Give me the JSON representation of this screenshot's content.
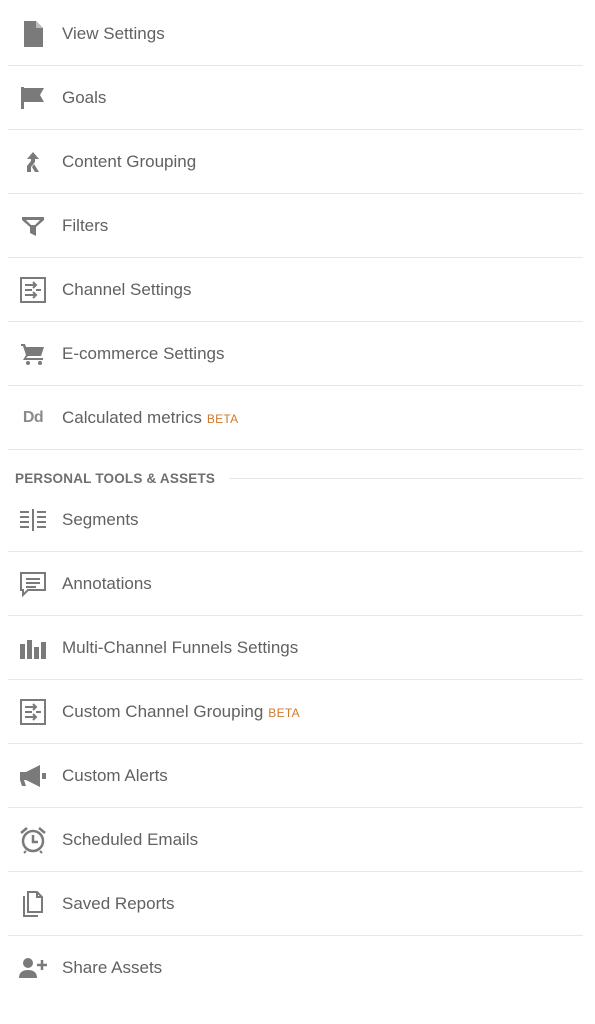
{
  "view_items": [
    {
      "label": "View Settings",
      "icon": "file-icon"
    },
    {
      "label": "Goals",
      "icon": "flag-icon"
    },
    {
      "label": "Content Grouping",
      "icon": "merge-icon"
    },
    {
      "label": "Filters",
      "icon": "filter-icon"
    },
    {
      "label": "Channel Settings",
      "icon": "channel-settings-icon"
    },
    {
      "label": "E-commerce Settings",
      "icon": "cart-icon"
    },
    {
      "label": "Calculated metrics",
      "badge": "BETA",
      "icon": "calculated-metrics-icon",
      "icon_text": "Dd"
    }
  ],
  "section": {
    "title": "PERSONAL TOOLS & ASSETS"
  },
  "personal_items": [
    {
      "label": "Segments",
      "icon": "segments-icon"
    },
    {
      "label": "Annotations",
      "icon": "annotation-icon"
    },
    {
      "label": "Multi-Channel Funnels Settings",
      "icon": "bar-chart-icon"
    },
    {
      "label": "Custom Channel Grouping",
      "badge": "BETA",
      "icon": "channel-grouping-icon"
    },
    {
      "label": "Custom Alerts",
      "icon": "megaphone-icon"
    },
    {
      "label": "Scheduled Emails",
      "icon": "alarm-clock-icon"
    },
    {
      "label": "Saved Reports",
      "icon": "documents-icon"
    },
    {
      "label": "Share Assets",
      "icon": "add-person-icon"
    }
  ],
  "colors": {
    "text": "#616161",
    "icon": "#7a7a7a",
    "badge": "#d07a2c",
    "divider": "#e8e8e8"
  }
}
